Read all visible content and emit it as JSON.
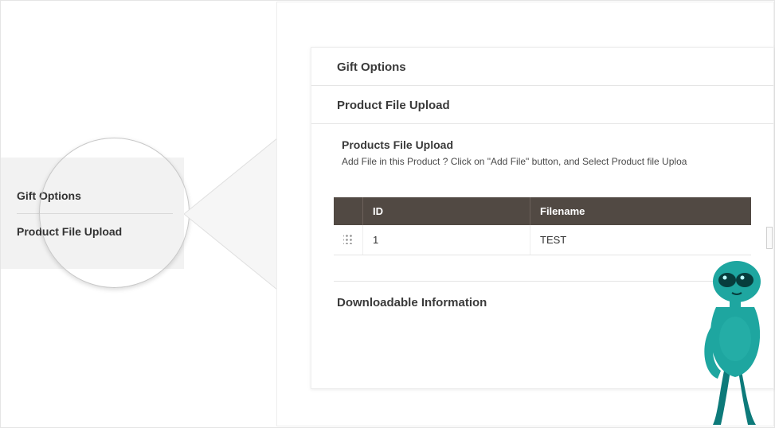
{
  "callout": {
    "items": [
      "Gift Options",
      "Product File Upload"
    ]
  },
  "sections": {
    "gift_options": "Gift Options",
    "product_file_upload": "Product File Upload",
    "downloadable_info": "Downloadable Information"
  },
  "upload_block": {
    "title": "Products File Upload",
    "hint": "Add File in this Product ? Click on \"Add File\" button, and Select Product file Uploa"
  },
  "table": {
    "headers": {
      "id": "ID",
      "filename": "Filename"
    },
    "rows": [
      {
        "id": "1",
        "filename": "TEST"
      }
    ]
  }
}
